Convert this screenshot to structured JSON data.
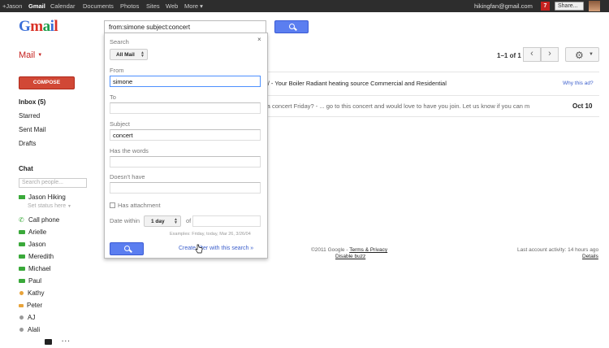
{
  "topbar": {
    "links": [
      "+Jason",
      "Gmail",
      "Calendar",
      "Documents",
      "Photos",
      "Sites",
      "Web",
      "More ▾"
    ],
    "email": "hikingfan@gmail.com",
    "notifications": "7",
    "share_label": "Share..."
  },
  "logo": {
    "letters": [
      "G",
      "m",
      "a",
      "i",
      "l"
    ]
  },
  "search": {
    "query": "from:simone subject:concert",
    "button_icon": "search-icon"
  },
  "mail_label": "Mail",
  "pager": {
    "text": "1–1 of 1",
    "prev": "‹",
    "next": "›"
  },
  "settings_icon": "gear-icon",
  "sidebar": {
    "compose": "COMPOSE",
    "folders": [
      "Inbox (5)",
      "Starred",
      "Sent Mail",
      "Drafts"
    ],
    "chat_label": "Chat",
    "chat_search_placeholder": "Search people...",
    "me": "Jason Hiking",
    "status": "Set status here",
    "contacts": [
      {
        "name": "Call phone",
        "status": "phone"
      },
      {
        "name": "Arielle",
        "status": "video"
      },
      {
        "name": "Jason",
        "status": "video"
      },
      {
        "name": "Meredith",
        "status": "video"
      },
      {
        "name": "Michael",
        "status": "video"
      },
      {
        "name": "Paul",
        "status": "video"
      },
      {
        "name": "Kathy",
        "status": "away"
      },
      {
        "name": "Peter",
        "status": "idle"
      },
      {
        "name": "AJ",
        "status": "offline"
      },
      {
        "name": "Alali",
        "status": "offline"
      }
    ]
  },
  "mail_list": {
    "ad": "s/ - Your Boiler Radiant heating source Commercial and Residential",
    "why_ad": "Why this ad?",
    "rows": [
      {
        "snippet": "or a concert Friday? - ... go to this concert and would love to have you join. Let us know if you can m",
        "date": "Oct 10"
      }
    ]
  },
  "footer": {
    "copyright": "©2011 Google - ",
    "terms": "Terms & Privacy",
    "disable": "Disable buzz",
    "activity": "Last account activity: 14 hours ago",
    "details": "Details"
  },
  "advanced_search": {
    "close": "×",
    "search_label": "Search",
    "mail_scope": "All Mail",
    "from_label": "From",
    "from_value": "simone",
    "to_label": "To",
    "to_value": "",
    "subject_label": "Subject",
    "subject_value": "concert",
    "has_words_label": "Has the words",
    "has_words_value": "",
    "doesnt_have_label": "Doesn't have",
    "doesnt_have_value": "",
    "has_attachment_label": "Has attachment",
    "has_attachment_checked": false,
    "date_within_label": "Date within",
    "date_within_value": "1 day",
    "of_label": "of",
    "date_value": "",
    "examples": "Examples: Friday, today, Mar 26, 3/26/04",
    "create_filter": "Create filter with this search »"
  }
}
